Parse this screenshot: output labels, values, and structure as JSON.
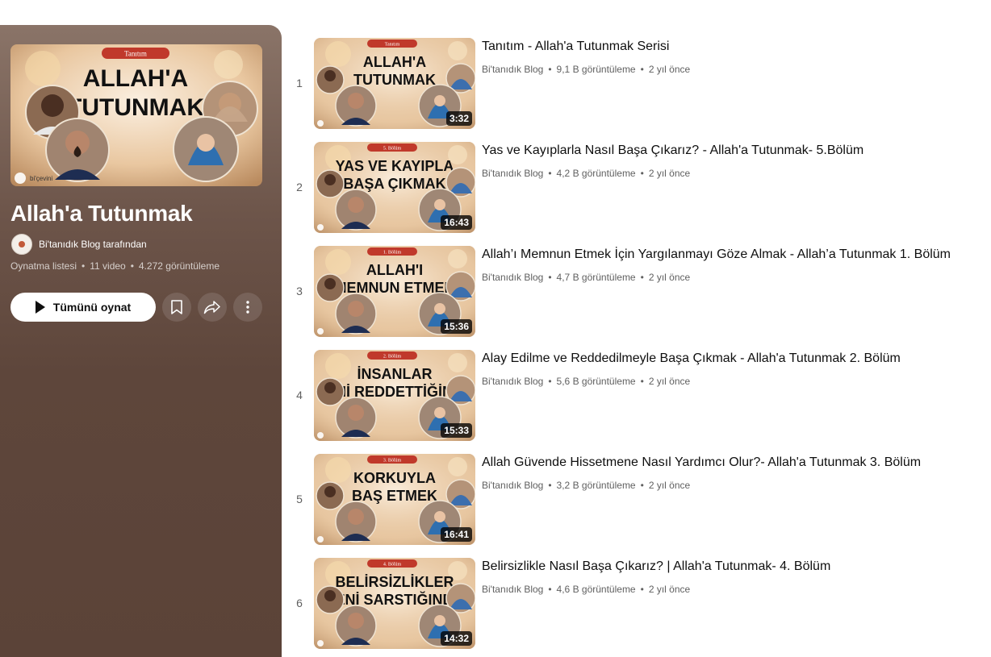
{
  "playlist": {
    "title": "Allah'a Tutunmak",
    "owner": "Bi'tanıdık Blog tarafından",
    "type": "Oynatma listesi",
    "video_count": "11 video",
    "views": "4.272 görüntüleme",
    "play_all_label": "Tümünü oynat",
    "hero": {
      "badge": "Tanıtım",
      "line1": "ALLAH'A",
      "line2": "TUTUNMAK",
      "logo": "bi'çevini"
    }
  },
  "colors": {
    "panel": "#5e463b",
    "badge": "#c0392b",
    "thumb_bg": "#e8c9a4"
  },
  "videos": [
    {
      "index": "1",
      "title": "Tanıtım - Allah'a Tutunmak Serisi",
      "channel": "Bi'tanıdık Blog",
      "views": "9,1 B görüntüleme",
      "age": "2 yıl önce",
      "duration": "3:32",
      "badge": "Tanıtım",
      "line1": "ALLAH'A",
      "line2": "TUTUNMAK"
    },
    {
      "index": "2",
      "title": "Yas ve Kayıplarla Nasıl Başa Çıkarız? - Allah'a Tutunmak- 5.Bölüm",
      "channel": "Bi'tanıdık Blog",
      "views": "4,2 B görüntüleme",
      "age": "2 yıl önce",
      "duration": "16:43",
      "badge": "5. Bölüm",
      "line1": "YAS VE KAYIPLA",
      "line2": "BAŞA ÇIKMAK"
    },
    {
      "index": "3",
      "title": "Allah’ı Memnun Etmek İçin Yargılanmayı Göze Almak - Allah’a Tutunmak 1. Bölüm",
      "channel": "Bi'tanıdık Blog",
      "views": "4,7 B görüntüleme",
      "age": "2 yıl önce",
      "duration": "15:36",
      "badge": "1. Bölüm",
      "line1": "ALLAH'I",
      "line2": "MEMNUN ETMEK"
    },
    {
      "index": "4",
      "title": "Alay Edilme ve Reddedilmeyle Başa Çıkmak - Allah'a Tutunmak 2. Bölüm",
      "channel": "Bi'tanıdık Blog",
      "views": "5,6 B görüntüleme",
      "age": "2 yıl önce",
      "duration": "15:33",
      "badge": "2. Bölüm",
      "line1": "İNSANLAR",
      "line2": "SENİ REDDETTİĞİNDE"
    },
    {
      "index": "5",
      "title": "Allah Güvende Hissetmene Nasıl Yardımcı Olur?- Allah'a Tutunmak 3. Bölüm",
      "channel": "Bi'tanıdık Blog",
      "views": "3,2 B görüntüleme",
      "age": "2 yıl önce",
      "duration": "16:41",
      "badge": "3. Bölüm",
      "line1": "KORKUYLA",
      "line2": "BAŞ ETMEK"
    },
    {
      "index": "6",
      "title": "Belirsizlikle Nasıl Başa Çıkarız? | Allah'a Tutunmak- 4. Bölüm",
      "channel": "Bi'tanıdık Blog",
      "views": "4,6 B görüntüleme",
      "age": "2 yıl önce",
      "duration": "14:32",
      "badge": "4. Bölüm",
      "line1": "BELİRSİZLİKLER",
      "line2": "SENİ SARSTIĞINDA"
    }
  ]
}
